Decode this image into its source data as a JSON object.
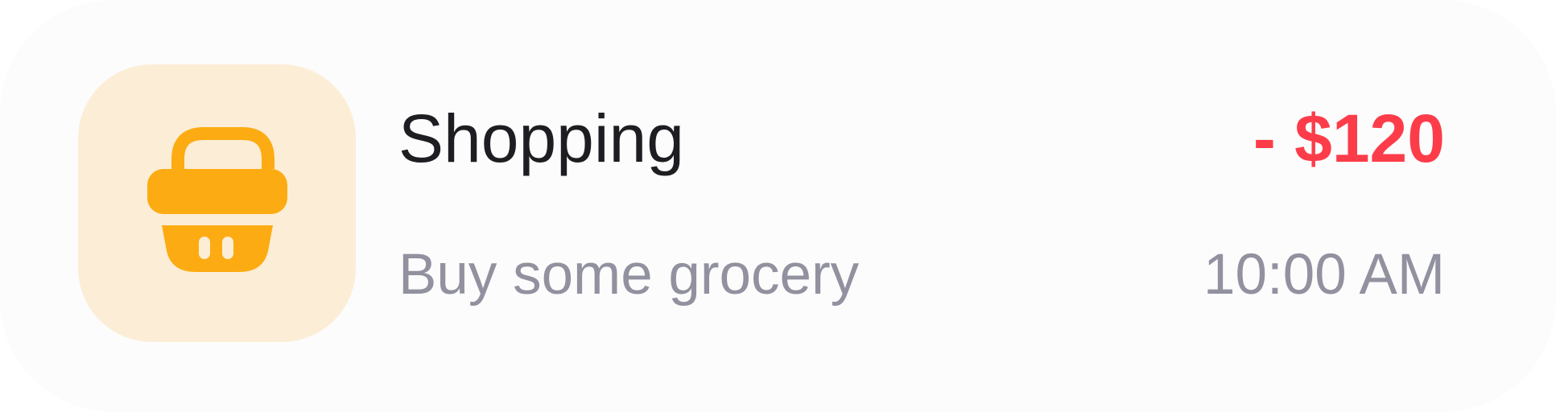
{
  "transaction": {
    "icon": "shopping-basket-icon",
    "category": "Shopping",
    "description": "Buy some grocery",
    "amount": "- $120",
    "time": "10:00 AM"
  },
  "colors": {
    "card_background": "#fcfcfc",
    "icon_tile_background": "#fcedd6",
    "icon_color": "#fcac12",
    "title_text": "#1e1e22",
    "secondary_text": "#91919f",
    "expense_amount": "#fd3c4a"
  }
}
